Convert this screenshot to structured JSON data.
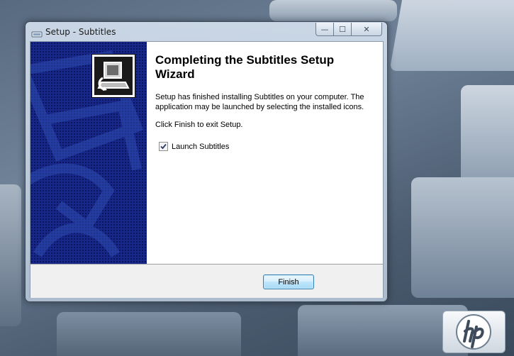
{
  "window": {
    "title": "Setup - Subtitles",
    "controls": {
      "minimize": "—",
      "maximize": "☐",
      "close": "✕"
    }
  },
  "wizard": {
    "heading": "Completing the Subtitles Setup Wizard",
    "message": "Setup has finished installing Subtitles on your computer. The application may be launched by selecting the installed icons.",
    "instruction": "Click Finish to exit Setup.",
    "launch_checkbox": {
      "label": "Launch Subtitles",
      "checked": true
    }
  },
  "footer": {
    "finish_label": "Finish"
  },
  "desktop": {
    "logo": "hp"
  },
  "colors": {
    "banner": "#18288a",
    "accent_button": "#bee6fd"
  }
}
